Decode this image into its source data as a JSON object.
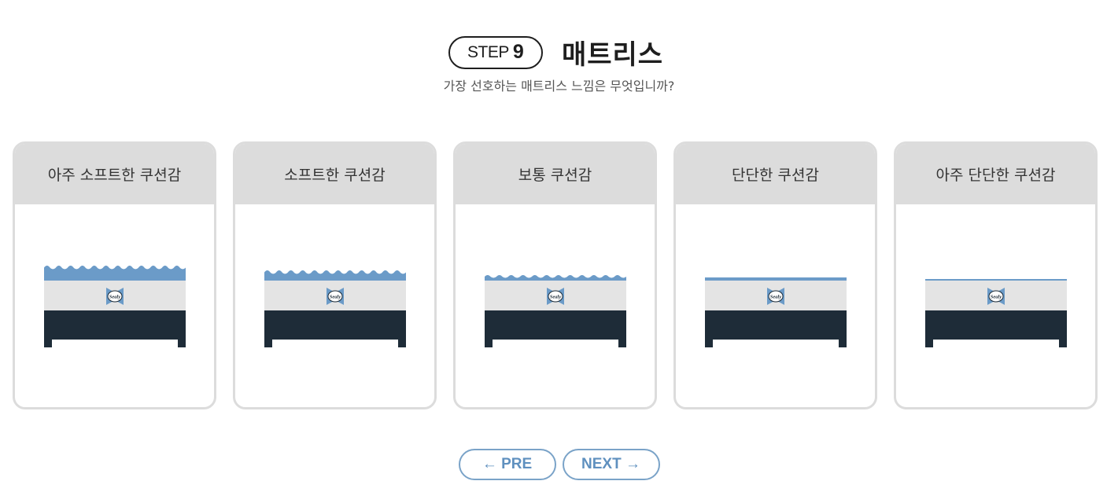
{
  "header": {
    "step_word": "STEP",
    "step_number": "9",
    "title": "매트리스",
    "subtitle": "가장 선호하는 매트리스 느낌은 무엇입니까?"
  },
  "options": [
    {
      "label": "아주 소프트한 쿠션감",
      "softness_level": 5
    },
    {
      "label": "소프트한 쿠션감",
      "softness_level": 4
    },
    {
      "label": "보통 쿠션감",
      "softness_level": 3
    },
    {
      "label": "단단한 쿠션감",
      "softness_level": 2
    },
    {
      "label": "아주 단단한 쿠션감",
      "softness_level": 1
    }
  ],
  "navigation": {
    "prev_label": "← PRE",
    "next_label": "NEXT →"
  },
  "brand_text": "Sealy",
  "colors": {
    "accent_blue": "#6b9bc8",
    "base_dark": "#1e2c38",
    "card_header_gray": "#dcdcdc",
    "mattress_gray": "#e4e4e4",
    "button_blue": "#5f90bf"
  }
}
